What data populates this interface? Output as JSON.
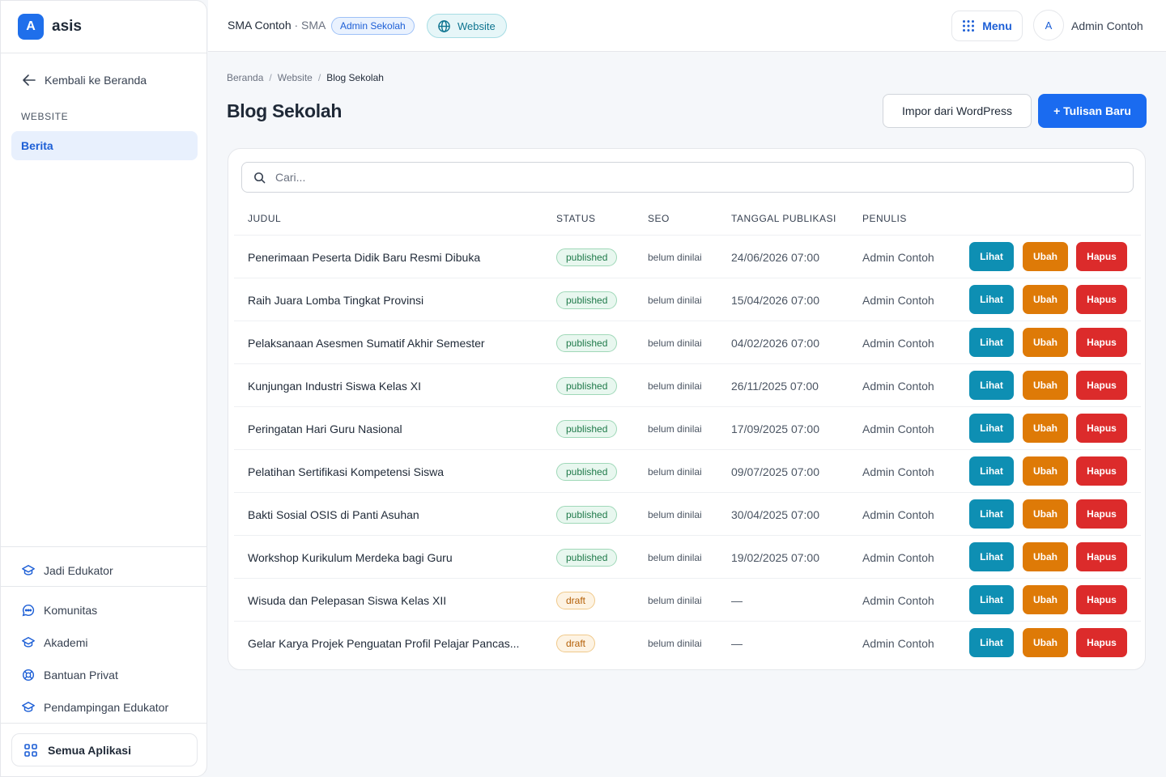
{
  "brand": {
    "logo_letter": "A",
    "name": "asis"
  },
  "sidebar": {
    "back_label": "Kembali ke Beranda",
    "section_label": "WEBSITE",
    "active_item": "Berita",
    "edukator_label": "Jadi Edukator",
    "links": [
      "Komunitas",
      "Akademi",
      "Bantuan Privat",
      "Pendampingan Edukator"
    ],
    "all_apps_label": "Semua Aplikasi"
  },
  "topbar": {
    "school_name": "SMA Contoh",
    "school_type": "· SMA",
    "role_badge": "Admin Sekolah",
    "website_badge": "Website",
    "menu_label": "Menu",
    "avatar_letter": "A",
    "user_name": "Admin Contoh"
  },
  "breadcrumb": [
    "Beranda",
    "Website",
    "Blog Sekolah"
  ],
  "page": {
    "title": "Blog Sekolah",
    "import_label": "Impor dari WordPress",
    "new_label": "+ Tulisan Baru"
  },
  "search": {
    "placeholder": "Cari..."
  },
  "table": {
    "headers": [
      "JUDUL",
      "STATUS",
      "SEO",
      "TANGGAL PUBLIKASI",
      "PENULIS"
    ],
    "action_labels": {
      "view": "Lihat",
      "edit": "Ubah",
      "delete": "Hapus"
    },
    "rows": [
      {
        "title": "Penerimaan Peserta Didik Baru Resmi Dibuka",
        "status": "published",
        "seo": "belum dinilai",
        "date": "24/06/2026 07:00",
        "author": "Admin Contoh"
      },
      {
        "title": "Raih Juara Lomba Tingkat Provinsi",
        "status": "published",
        "seo": "belum dinilai",
        "date": "15/04/2026 07:00",
        "author": "Admin Contoh"
      },
      {
        "title": "Pelaksanaan Asesmen Sumatif Akhir Semester",
        "status": "published",
        "seo": "belum dinilai",
        "date": "04/02/2026 07:00",
        "author": "Admin Contoh"
      },
      {
        "title": "Kunjungan Industri Siswa Kelas XI",
        "status": "published",
        "seo": "belum dinilai",
        "date": "26/11/2025 07:00",
        "author": "Admin Contoh"
      },
      {
        "title": "Peringatan Hari Guru Nasional",
        "status": "published",
        "seo": "belum dinilai",
        "date": "17/09/2025 07:00",
        "author": "Admin Contoh"
      },
      {
        "title": "Pelatihan Sertifikasi Kompetensi Siswa",
        "status": "published",
        "seo": "belum dinilai",
        "date": "09/07/2025 07:00",
        "author": "Admin Contoh"
      },
      {
        "title": "Bakti Sosial OSIS di Panti Asuhan",
        "status": "published",
        "seo": "belum dinilai",
        "date": "30/04/2025 07:00",
        "author": "Admin Contoh"
      },
      {
        "title": "Workshop Kurikulum Merdeka bagi Guru",
        "status": "published",
        "seo": "belum dinilai",
        "date": "19/02/2025 07:00",
        "author": "Admin Contoh"
      },
      {
        "title": "Wisuda dan Pelepasan Siswa Kelas XII",
        "status": "draft",
        "seo": "belum dinilai",
        "date": "—",
        "author": "Admin Contoh"
      },
      {
        "title": "Gelar Karya Projek Penguatan Profil Pelajar Pancas...",
        "status": "draft",
        "seo": "belum dinilai",
        "date": "—",
        "author": "Admin Contoh"
      }
    ]
  },
  "colors": {
    "primary": "#1a6bf0",
    "view": "#0e8fb3",
    "edit": "#de7a07",
    "delete": "#dc2b2b"
  }
}
